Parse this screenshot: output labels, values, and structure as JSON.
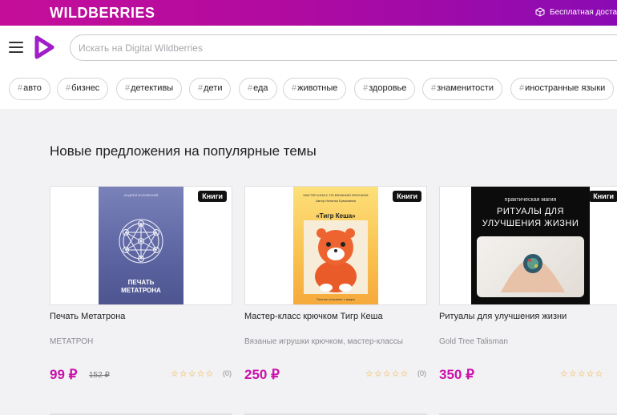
{
  "brand": {
    "logo": "WILDBERRIES",
    "delivery_text": "Бесплатная достав"
  },
  "search": {
    "placeholder": "Искать на Digital Wildberries"
  },
  "tags": [
    {
      "label": "авто"
    },
    {
      "label": "бизнес"
    },
    {
      "label": "детективы"
    },
    {
      "label": "дети"
    },
    {
      "label": "еда"
    },
    {
      "label": "животные"
    },
    {
      "label": "здоровье"
    },
    {
      "label": "знаменитости"
    },
    {
      "label": "иностранные языки"
    }
  ],
  "section": {
    "title": "Новые предложения на популярные темы"
  },
  "products": [
    {
      "badge": "Книги",
      "cover_author": "АНДРЕЙ ЖУКОВСКИЙ",
      "cover_title": "ПЕЧАТЬ МЕТАТРОНА",
      "name": "Печать Метатрона",
      "brand": "МЕТАТРОН",
      "price": "99 ₽",
      "old_price": "152 ₽",
      "stars": "☆☆☆☆☆",
      "reviews": "(0)"
    },
    {
      "badge": "Книги",
      "cover_top": "МАСТЕР-КЛАСС ПО ВЯЗАНИЮ КРЮЧКОМ",
      "cover_author": "Автор Наталья Ермолаева",
      "cover_title": "«Тигр Кеша»",
      "cover_bottom": "Полное описание с видео",
      "name": "Мастер-класс крючком Тигр Кеша",
      "brand": "Вязаные игрушки крючком, мастер-классы",
      "price": "250 ₽",
      "stars": "☆☆☆☆☆",
      "reviews": "(0)"
    },
    {
      "badge": "Книги",
      "cover_top": "практическая магия",
      "cover_title": "РИТУАЛЫ ДЛЯ УЛУЧШЕНИЯ ЖИЗНИ",
      "name": "Ритуалы для улучшения жизни",
      "brand": "Gold Tree Talisman",
      "price": "350 ₽",
      "stars": "☆☆☆☆☆",
      "reviews": ""
    }
  ]
}
